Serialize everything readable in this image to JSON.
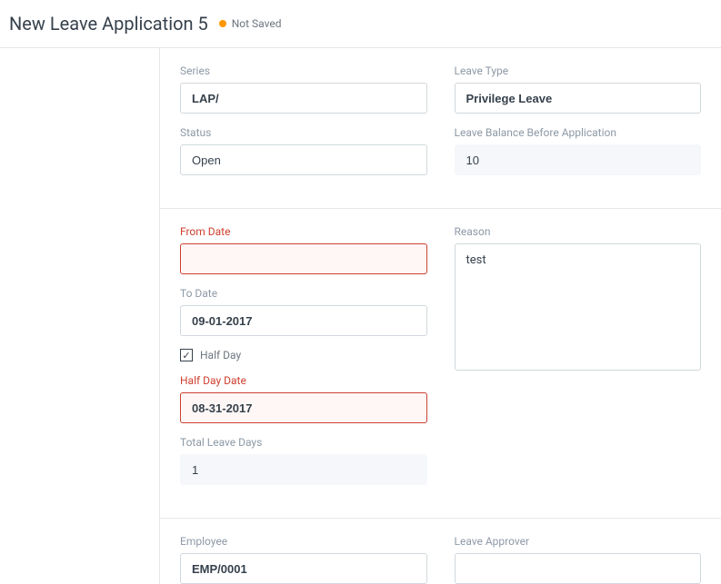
{
  "header": {
    "title": "New Leave Application 5",
    "status_text": "Not Saved"
  },
  "section1": {
    "left": {
      "series_label": "Series",
      "series_value": "LAP/",
      "status_label": "Status",
      "status_value": "Open"
    },
    "right": {
      "leave_type_label": "Leave Type",
      "leave_type_value": "Privilege Leave",
      "balance_label": "Leave Balance Before Application",
      "balance_value": "10"
    }
  },
  "section2": {
    "left": {
      "from_date_label": "From Date",
      "from_date_value": "",
      "to_date_label": "To Date",
      "to_date_value": "09-01-2017",
      "half_day_label": "Half Day",
      "half_day_checked": "✓",
      "half_day_date_label": "Half Day Date",
      "half_day_date_value": "08-31-2017",
      "total_days_label": "Total Leave Days",
      "total_days_value": "1"
    },
    "right": {
      "reason_label": "Reason",
      "reason_value": "test"
    }
  },
  "section3": {
    "left": {
      "employee_label": "Employee",
      "employee_value": "EMP/0001"
    },
    "right": {
      "approver_label": "Leave Approver",
      "approver_value": ""
    }
  }
}
